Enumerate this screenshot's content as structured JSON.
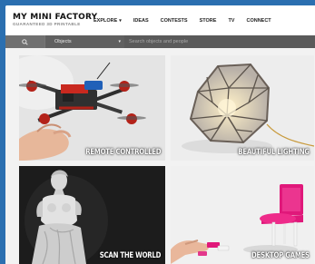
{
  "brand": {
    "title": "MY MINI FACTORY",
    "tagline": "GUARANTEED 3D PRINTABLE"
  },
  "nav": {
    "items": [
      {
        "label": "EXPLORE",
        "has_dropdown": true
      },
      {
        "label": "IDEAS"
      },
      {
        "label": "CONTESTS"
      },
      {
        "label": "STORE"
      },
      {
        "label": "TV"
      },
      {
        "label": "CONNECT"
      }
    ]
  },
  "search": {
    "icon": "search-icon",
    "category": "Objects",
    "placeholder": "Search objects and people"
  },
  "tiles": [
    {
      "label": "REMOTE CONTROLLED",
      "image": "quadcopter-drone"
    },
    {
      "label": "BEAUTIFUL LIGHTING",
      "image": "geometric-lamp"
    },
    {
      "label": "SCAN THE WORLD",
      "image": "venus-de-milo-statue"
    },
    {
      "label": "DESKTOP GAMES",
      "image": "pink-mini-chair"
    }
  ],
  "colors": {
    "background": "#2b6fb0",
    "topbar": "#ffffff",
    "searchbar": "#5a5a5a",
    "search_button": "#707070"
  }
}
